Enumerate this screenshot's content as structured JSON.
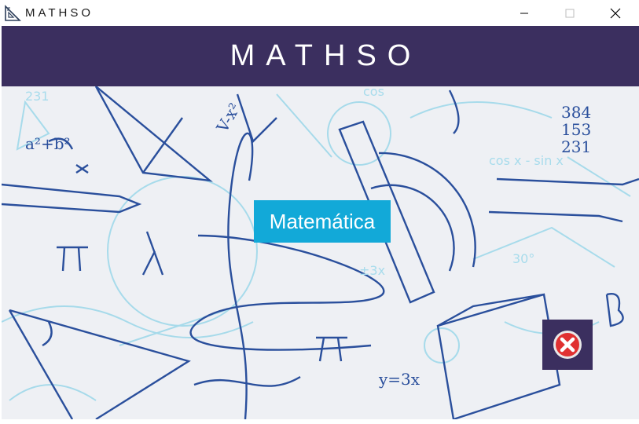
{
  "window": {
    "title": "MATHSO",
    "icons": {
      "app": "set-square-icon",
      "minimize": "minimize-icon",
      "maximize": "maximize-icon",
      "close": "close-icon"
    }
  },
  "header": {
    "title": "MATHSO",
    "color": "#3b2f5f"
  },
  "main": {
    "background": "math-doodles",
    "subject_button": {
      "label": "Matemática",
      "color": "#12a9d8"
    },
    "exit_button": {
      "icon": "red-x-icon",
      "color": "#e03131"
    }
  }
}
